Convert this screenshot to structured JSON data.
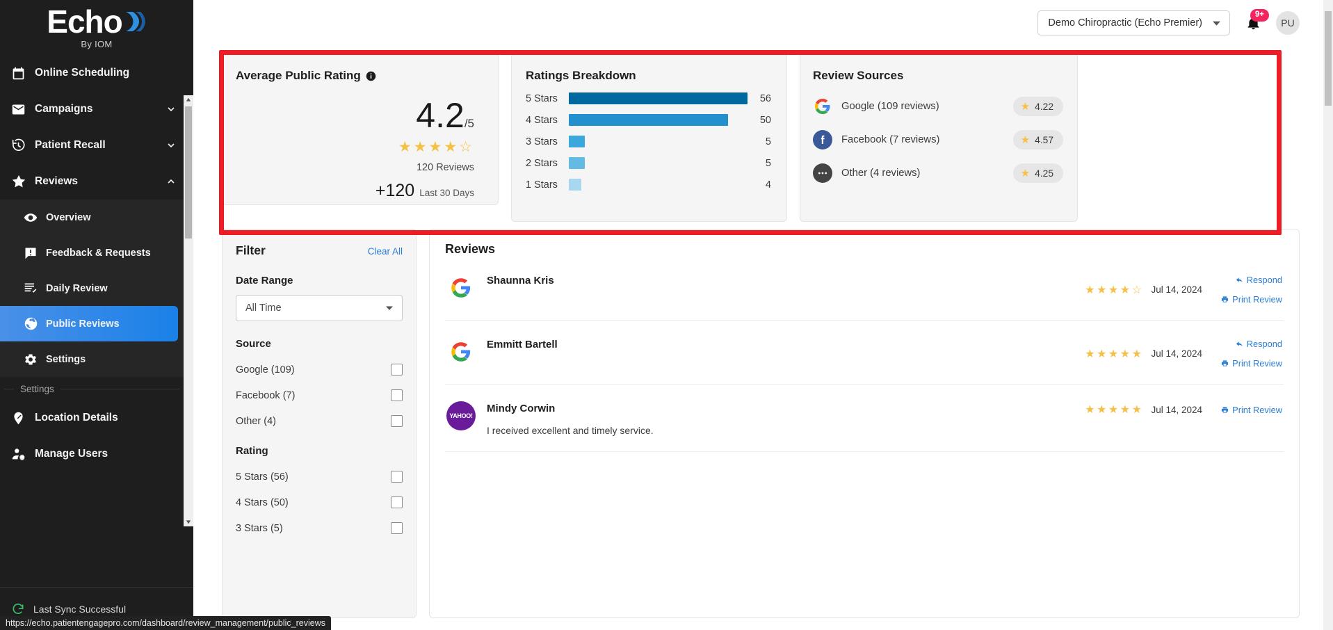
{
  "brand": {
    "name": "Echo",
    "sub": "By IOM"
  },
  "sidebar": {
    "items": [
      {
        "label": "Online Scheduling",
        "icon": "calendar-icon",
        "chevron": ""
      },
      {
        "label": "Campaigns",
        "icon": "envelope-icon",
        "chevron": "down"
      },
      {
        "label": "Patient Recall",
        "icon": "history-icon",
        "chevron": "down"
      },
      {
        "label": "Reviews",
        "icon": "star-icon",
        "chevron": "up"
      }
    ],
    "subitems": [
      {
        "label": "Overview",
        "icon": "eye-icon",
        "active": false
      },
      {
        "label": "Feedback & Requests",
        "icon": "feedback-icon",
        "active": false
      },
      {
        "label": "Daily Review",
        "icon": "daily-review-icon",
        "active": false
      },
      {
        "label": "Public Reviews",
        "icon": "globe-icon",
        "active": true
      },
      {
        "label": "Settings",
        "icon": "gear-icon",
        "active": false
      }
    ],
    "section_label": "Settings",
    "settings_items": [
      {
        "label": "Location Details",
        "icon": "location-edit-icon"
      },
      {
        "label": "Manage Users",
        "icon": "manage-users-icon"
      }
    ],
    "footer": {
      "label": "Last Sync Successful",
      "icon": "sync-icon"
    }
  },
  "topbar": {
    "org": "Demo Chiropractic (Echo Premier)",
    "notifications_badge": "9+",
    "avatar_initials": "PU"
  },
  "avg_card": {
    "title": "Average Public Rating",
    "info_icon": "info-icon",
    "value": "4.2",
    "out_of": "/5",
    "stars_filled": 4,
    "stars_total": 5,
    "reviews_label": "120 Reviews",
    "delta": "+120",
    "delta_period": "Last 30 Days"
  },
  "chart_data": {
    "type": "bar",
    "title": "Ratings Breakdown",
    "orientation": "horizontal",
    "categories": [
      "5 Stars",
      "4 Stars",
      "3 Stars",
      "2 Stars",
      "1 Stars"
    ],
    "values": [
      56,
      50,
      5,
      5,
      4
    ],
    "bar_colors": [
      "#0068a0",
      "#2190cc",
      "#3aa7dd",
      "#63bbe4",
      "#a7d8ef"
    ],
    "xlabel": "",
    "ylabel": "",
    "xlim": [
      0,
      56
    ],
    "grid": false,
    "legend": false,
    "value_labels": [
      "56",
      "50",
      "5",
      "5",
      "4"
    ]
  },
  "sources_card": {
    "title": "Review Sources",
    "rows": [
      {
        "name": "Google (109 reviews)",
        "rating": "4.22",
        "icon": "google-icon"
      },
      {
        "name": "Facebook (7 reviews)",
        "rating": "4.57",
        "icon": "facebook-icon"
      },
      {
        "name": "Other (4 reviews)",
        "rating": "4.25",
        "icon": "other-icon"
      }
    ]
  },
  "filter": {
    "title": "Filter",
    "clear_all": "Clear All",
    "date_range_label": "Date Range",
    "date_range_value": "All Time",
    "source_label": "Source",
    "sources": [
      "Google (109)",
      "Facebook (7)",
      "Other (4)"
    ],
    "rating_label": "Rating",
    "ratings": [
      "5 Stars (56)",
      "4 Stars (50)",
      "3 Stars (5)"
    ]
  },
  "reviews": {
    "title": "Reviews",
    "items": [
      {
        "name": "Shaunna Kris",
        "avatar": "google-icon",
        "stars_filled": 4,
        "date": "Jul 14, 2024",
        "text": "",
        "actions": [
          "Respond",
          "Print Review"
        ]
      },
      {
        "name": "Emmitt Bartell",
        "avatar": "google-icon",
        "stars_filled": 5,
        "date": "Jul 14, 2024",
        "text": "",
        "actions": [
          "Respond",
          "Print Review"
        ]
      },
      {
        "name": "Mindy Corwin",
        "avatar": "yahoo-icon",
        "stars_filled": 5,
        "date": "Jul 14, 2024",
        "text": "I received excellent and timely service.",
        "actions": [
          "Print Review"
        ]
      }
    ]
  },
  "statusbar": {
    "url": "https://echo.patientengagepro.com/dashboard/review_management/public_reviews"
  },
  "colors": {
    "accent": "#2b7dd4",
    "highlight": "#ee1c25",
    "star": "#f5c046",
    "sidebar": "#1e1e1e"
  }
}
